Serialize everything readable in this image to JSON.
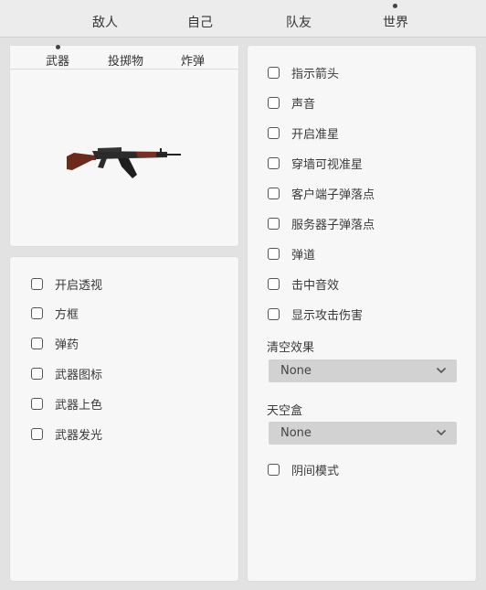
{
  "top_tabs": [
    "敌人",
    "自己",
    "队友",
    "世界"
  ],
  "weapon_tabs": [
    "武器",
    "投掷物",
    "炸弹"
  ],
  "weapon_options": [
    "开启透视",
    "方框",
    "弹药",
    "武器图标",
    "武器上色",
    "武器发光"
  ],
  "world_options": [
    "指示箭头",
    "声音",
    "开启准星",
    "穿墙可视准星",
    "客户端子弹落点",
    "服务器子弹落点",
    "弹道",
    "击中音效",
    "显示攻击伤害"
  ],
  "clear_effect": {
    "label": "清空效果",
    "value": "None"
  },
  "skybox": {
    "label": "天空盒",
    "value": "None"
  },
  "dark_mode": "阴间模式",
  "preview": {
    "icon": "rifle-icon"
  }
}
